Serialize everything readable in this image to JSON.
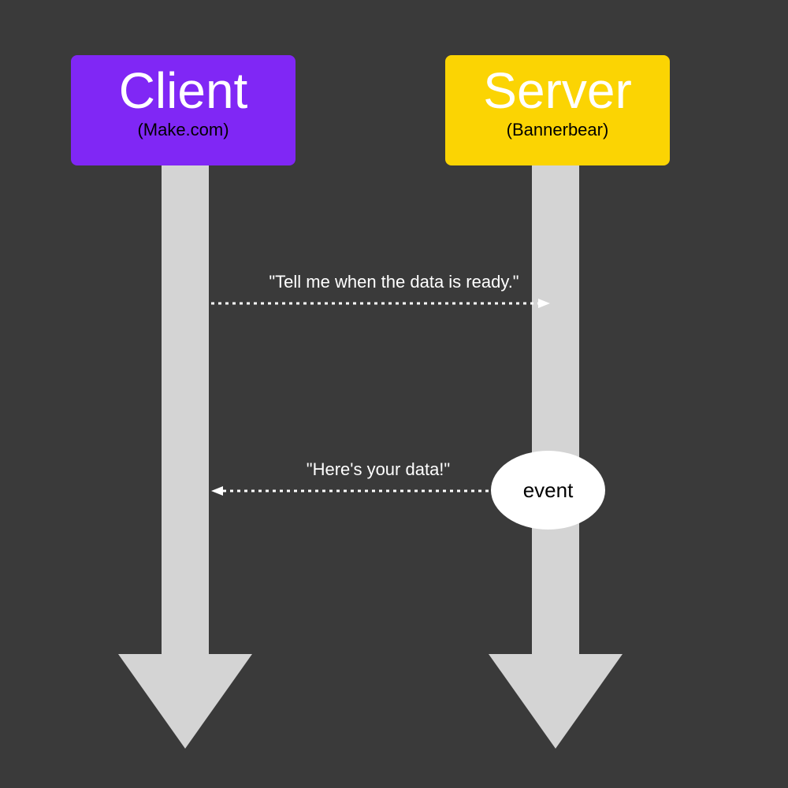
{
  "client": {
    "title": "Client",
    "subtitle": "(Make.com)"
  },
  "server": {
    "title": "Server",
    "subtitle": "(Bannerbear)"
  },
  "messages": {
    "request": "\"Tell me when the data is ready.\"",
    "response": "\"Here's your data!\""
  },
  "event_label": "event",
  "colors": {
    "background": "#3a3a3a",
    "client_bg": "#8027f5",
    "server_bg": "#fbd403",
    "arrow_fill": "#d4d4d4",
    "text_light": "#ffffff",
    "text_dark": "#000000"
  }
}
